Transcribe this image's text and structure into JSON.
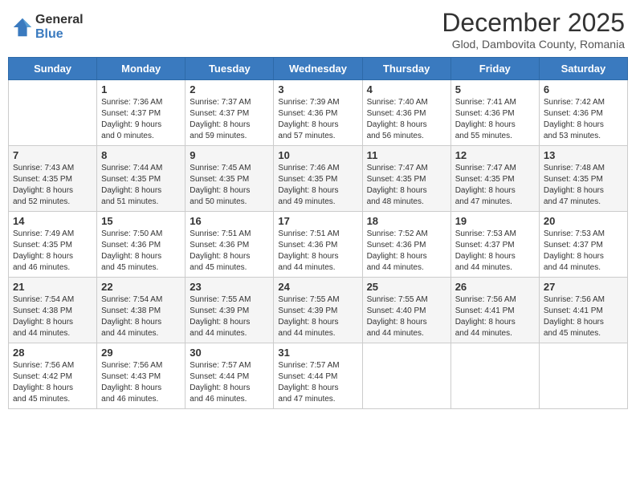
{
  "logo": {
    "general": "General",
    "blue": "Blue"
  },
  "title": {
    "month_year": "December 2025",
    "location": "Glod, Dambovita County, Romania"
  },
  "headers": [
    "Sunday",
    "Monday",
    "Tuesday",
    "Wednesday",
    "Thursday",
    "Friday",
    "Saturday"
  ],
  "weeks": [
    [
      {
        "day": "",
        "info": ""
      },
      {
        "day": "1",
        "info": "Sunrise: 7:36 AM\nSunset: 4:37 PM\nDaylight: 9 hours\nand 0 minutes."
      },
      {
        "day": "2",
        "info": "Sunrise: 7:37 AM\nSunset: 4:37 PM\nDaylight: 8 hours\nand 59 minutes."
      },
      {
        "day": "3",
        "info": "Sunrise: 7:39 AM\nSunset: 4:36 PM\nDaylight: 8 hours\nand 57 minutes."
      },
      {
        "day": "4",
        "info": "Sunrise: 7:40 AM\nSunset: 4:36 PM\nDaylight: 8 hours\nand 56 minutes."
      },
      {
        "day": "5",
        "info": "Sunrise: 7:41 AM\nSunset: 4:36 PM\nDaylight: 8 hours\nand 55 minutes."
      },
      {
        "day": "6",
        "info": "Sunrise: 7:42 AM\nSunset: 4:36 PM\nDaylight: 8 hours\nand 53 minutes."
      }
    ],
    [
      {
        "day": "7",
        "info": "Sunrise: 7:43 AM\nSunset: 4:35 PM\nDaylight: 8 hours\nand 52 minutes."
      },
      {
        "day": "8",
        "info": "Sunrise: 7:44 AM\nSunset: 4:35 PM\nDaylight: 8 hours\nand 51 minutes."
      },
      {
        "day": "9",
        "info": "Sunrise: 7:45 AM\nSunset: 4:35 PM\nDaylight: 8 hours\nand 50 minutes."
      },
      {
        "day": "10",
        "info": "Sunrise: 7:46 AM\nSunset: 4:35 PM\nDaylight: 8 hours\nand 49 minutes."
      },
      {
        "day": "11",
        "info": "Sunrise: 7:47 AM\nSunset: 4:35 PM\nDaylight: 8 hours\nand 48 minutes."
      },
      {
        "day": "12",
        "info": "Sunrise: 7:47 AM\nSunset: 4:35 PM\nDaylight: 8 hours\nand 47 minutes."
      },
      {
        "day": "13",
        "info": "Sunrise: 7:48 AM\nSunset: 4:35 PM\nDaylight: 8 hours\nand 47 minutes."
      }
    ],
    [
      {
        "day": "14",
        "info": "Sunrise: 7:49 AM\nSunset: 4:35 PM\nDaylight: 8 hours\nand 46 minutes."
      },
      {
        "day": "15",
        "info": "Sunrise: 7:50 AM\nSunset: 4:36 PM\nDaylight: 8 hours\nand 45 minutes."
      },
      {
        "day": "16",
        "info": "Sunrise: 7:51 AM\nSunset: 4:36 PM\nDaylight: 8 hours\nand 45 minutes."
      },
      {
        "day": "17",
        "info": "Sunrise: 7:51 AM\nSunset: 4:36 PM\nDaylight: 8 hours\nand 44 minutes."
      },
      {
        "day": "18",
        "info": "Sunrise: 7:52 AM\nSunset: 4:36 PM\nDaylight: 8 hours\nand 44 minutes."
      },
      {
        "day": "19",
        "info": "Sunrise: 7:53 AM\nSunset: 4:37 PM\nDaylight: 8 hours\nand 44 minutes."
      },
      {
        "day": "20",
        "info": "Sunrise: 7:53 AM\nSunset: 4:37 PM\nDaylight: 8 hours\nand 44 minutes."
      }
    ],
    [
      {
        "day": "21",
        "info": "Sunrise: 7:54 AM\nSunset: 4:38 PM\nDaylight: 8 hours\nand 44 minutes."
      },
      {
        "day": "22",
        "info": "Sunrise: 7:54 AM\nSunset: 4:38 PM\nDaylight: 8 hours\nand 44 minutes."
      },
      {
        "day": "23",
        "info": "Sunrise: 7:55 AM\nSunset: 4:39 PM\nDaylight: 8 hours\nand 44 minutes."
      },
      {
        "day": "24",
        "info": "Sunrise: 7:55 AM\nSunset: 4:39 PM\nDaylight: 8 hours\nand 44 minutes."
      },
      {
        "day": "25",
        "info": "Sunrise: 7:55 AM\nSunset: 4:40 PM\nDaylight: 8 hours\nand 44 minutes."
      },
      {
        "day": "26",
        "info": "Sunrise: 7:56 AM\nSunset: 4:41 PM\nDaylight: 8 hours\nand 44 minutes."
      },
      {
        "day": "27",
        "info": "Sunrise: 7:56 AM\nSunset: 4:41 PM\nDaylight: 8 hours\nand 45 minutes."
      }
    ],
    [
      {
        "day": "28",
        "info": "Sunrise: 7:56 AM\nSunset: 4:42 PM\nDaylight: 8 hours\nand 45 minutes."
      },
      {
        "day": "29",
        "info": "Sunrise: 7:56 AM\nSunset: 4:43 PM\nDaylight: 8 hours\nand 46 minutes."
      },
      {
        "day": "30",
        "info": "Sunrise: 7:57 AM\nSunset: 4:44 PM\nDaylight: 8 hours\nand 46 minutes."
      },
      {
        "day": "31",
        "info": "Sunrise: 7:57 AM\nSunset: 4:44 PM\nDaylight: 8 hours\nand 47 minutes."
      },
      {
        "day": "",
        "info": ""
      },
      {
        "day": "",
        "info": ""
      },
      {
        "day": "",
        "info": ""
      }
    ]
  ]
}
